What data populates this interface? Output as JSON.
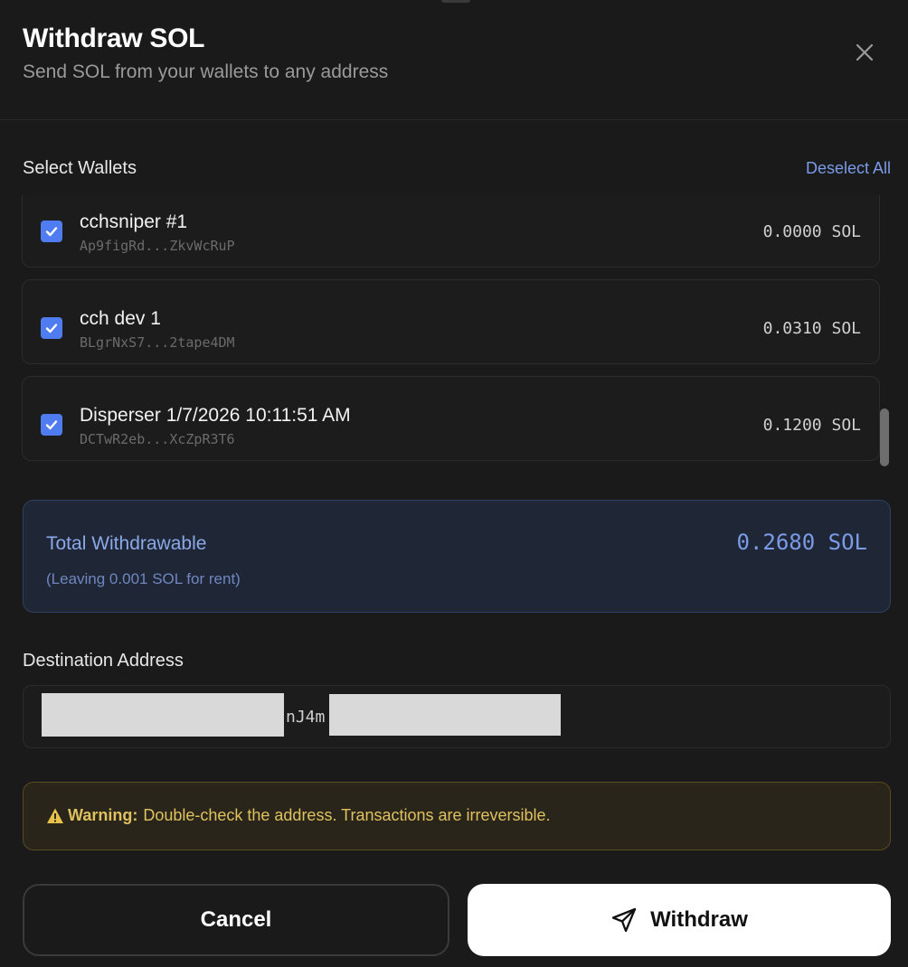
{
  "header": {
    "title": "Withdraw SOL",
    "subtitle": "Send SOL from your wallets to any address",
    "close_icon": "close-icon"
  },
  "wallets_section": {
    "label": "Select Wallets",
    "deselect_label": "Deselect All",
    "items": [
      {
        "name": "cchsniper #1",
        "address": "Ap9figRd...ZkvWcRuP",
        "balance": "0.0000 SOL",
        "checked": true
      },
      {
        "name": "cch dev 1",
        "address": "BLgrNxS7...2tape4DM",
        "balance": "0.0310 SOL",
        "checked": true
      },
      {
        "name": "Disperser 1/7/2026 10:11:51 AM",
        "address": "DCTwR2eb...XcZpR3T6",
        "balance": "0.1200 SOL",
        "checked": true
      }
    ]
  },
  "total": {
    "label": "Total Withdrawable",
    "value": "0.2680 SOL",
    "note": "(Leaving 0.001 SOL for rent)"
  },
  "destination": {
    "label": "Destination Address",
    "value": "nJ4m"
  },
  "warning": {
    "icon": "warning-icon",
    "strong": "Warning:",
    "text": "Double-check the address. Transactions are irreversible."
  },
  "actions": {
    "cancel_label": "Cancel",
    "withdraw_label": "Withdraw",
    "withdraw_icon": "send-icon"
  },
  "colors": {
    "accent": "#4f7cf0",
    "link": "#7b9be8",
    "warning": "#e0c160",
    "background": "#1a1a1a"
  }
}
